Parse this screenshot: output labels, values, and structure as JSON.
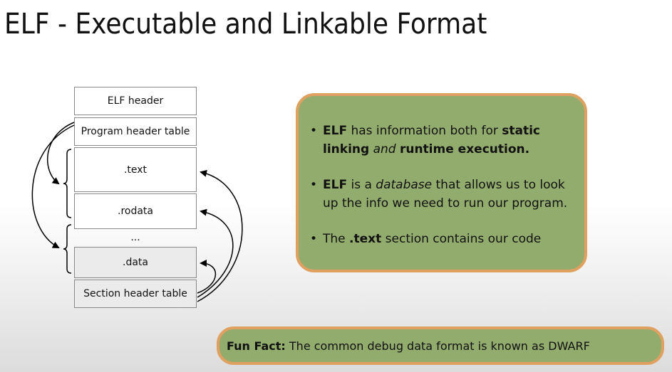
{
  "title": "ELF - Executable and Linkable Format",
  "diagram": {
    "segments": [
      {
        "label": "ELF header"
      },
      {
        "label": "Program header table"
      },
      {
        "label": ".text"
      },
      {
        "label": ".rodata"
      },
      {
        "label": "..."
      },
      {
        "label": ".data"
      },
      {
        "label": "Section header table"
      }
    ]
  },
  "info": {
    "bullets": [
      {
        "b1_bold1": "ELF",
        "b1_t1": " has information both for ",
        "b1_bold2": "static linking",
        "b1_t2": " ",
        "b1_italic": "and",
        "b1_t3": " ",
        "b1_bold3": "runtime execution."
      },
      {
        "b2_bold": "ELF",
        "b2_t1": " is a ",
        "b2_italic": "database",
        "b2_t2": " that allows us to look up the info we need to run our program."
      },
      {
        "b3_t1": "The ",
        "b3_bold": ".text",
        "b3_t2": " section contains our code"
      }
    ]
  },
  "fun_fact": {
    "label": "Fun Fact:",
    "text": " The common debug data format is known as DWARF"
  },
  "colors": {
    "box_fill": "#92ac6e",
    "box_border": "#e0a060"
  }
}
